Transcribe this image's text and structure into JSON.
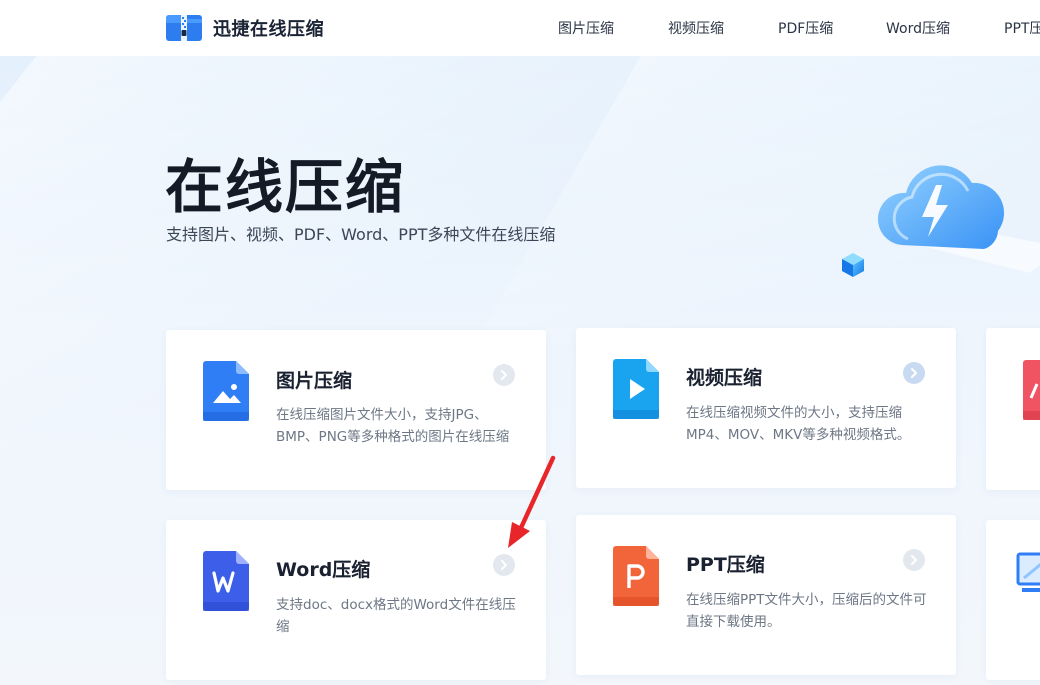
{
  "header": {
    "brand": "迅捷在线压缩",
    "nav": [
      "图片压缩",
      "视频压缩",
      "PDF压缩",
      "Word压缩",
      "PPT压"
    ]
  },
  "hero": {
    "title": "在线压缩",
    "subtitle": "支持图片、视频、PDF、Word、PPT多种文件在线压缩"
  },
  "cards": [
    {
      "icon": "image-file-icon",
      "title": "图片压缩",
      "desc": "在线压缩图片文件大小，支持JPG、BMP、PNG等多种格式的图片在线压缩",
      "color": "#2f7ef5"
    },
    {
      "icon": "video-file-icon",
      "title": "视频压缩",
      "desc": "在线压缩视频文件的大小，支持压缩MP4、MOV、MKV等多种视频格式。",
      "color": "#1aa3ef"
    },
    {
      "icon": "word-file-icon",
      "title": "Word压缩",
      "desc": "支持doc、docx格式的Word文件在线压缩",
      "color": "#3c5ee8"
    },
    {
      "icon": "ppt-file-icon",
      "title": "PPT压缩",
      "desc": "在线压缩PPT文件大小，压缩后的文件可直接下载使用。",
      "color": "#f2643a"
    }
  ],
  "colors": {
    "accent_blue": "#2f7ef5",
    "chevron_bg": "#e3e8ef",
    "chevron_bg_active": "#c8d9f2",
    "pdf_red": "#f05463",
    "annotation_red": "#e8262a"
  }
}
